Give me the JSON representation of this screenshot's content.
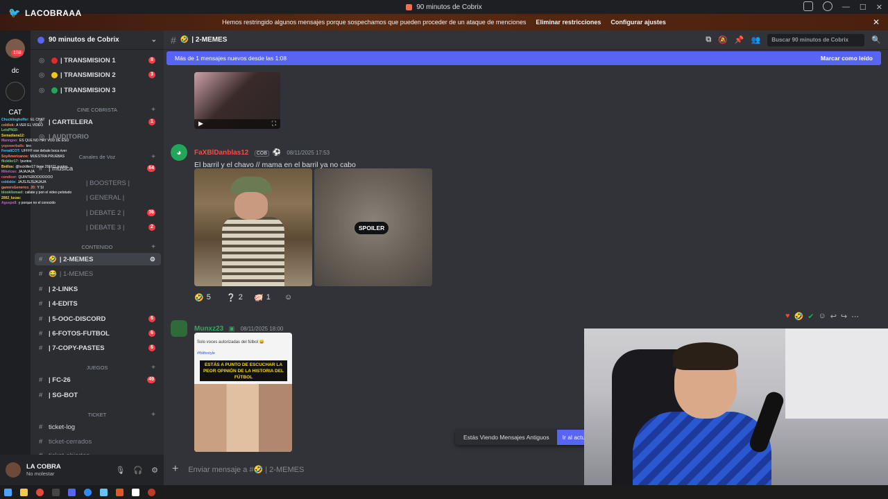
{
  "window": {
    "title": "90 minutos de Cobrix",
    "controls": [
      "—",
      "☐",
      "✕"
    ]
  },
  "stream_logo": "LACOBRAAA",
  "warning": {
    "text": "Hemos restringido algunos mensajes porque sospechamos que pueden proceder de un ataque de menciones",
    "link1": "Eliminar restricciones",
    "link2": "Configurar ajustes",
    "close": "✕"
  },
  "rail": {
    "items": [
      "dc",
      "CAT"
    ],
    "badge": "188"
  },
  "server": {
    "name": "90 minutos de Cobrix",
    "chevron": "⌄"
  },
  "channels": [
    {
      "label": "| TRANSMISION 1",
      "dot": "#e02b2b",
      "count": "8"
    },
    {
      "label": "| TRANSMISION 2",
      "dot": "#f0c419",
      "count": "3"
    },
    {
      "label": "| TRANSMISION 3",
      "dot": "#23a55a",
      "count": ""
    },
    {
      "label": "| CARTELERA",
      "count": "1"
    },
    {
      "label": "| AUDITORIO",
      "count": ""
    },
    {
      "label": "| musica",
      "count": "64"
    },
    {
      "label": "| BOOSTERS |",
      "count": ""
    },
    {
      "label": "| GENERAL |",
      "count": ""
    },
    {
      "label": "| DEBATE 2 |",
      "count": "36"
    },
    {
      "label": "| DEBATE 3 |",
      "count": "2"
    },
    {
      "label": "| 2-MEMES",
      "count": ""
    },
    {
      "label": "| 1-MEMES",
      "count": ""
    },
    {
      "label": "| 2-LINKS",
      "count": ""
    },
    {
      "label": "| 4-EDITS",
      "count": ""
    },
    {
      "label": "| 5-OOC-DISCORD",
      "count": "6"
    },
    {
      "label": "| 6-FOTOS-FUTBOL",
      "count": "6"
    },
    {
      "label": "| 7-COPY-PASTES",
      "count": "6"
    },
    {
      "label": "| FC-26",
      "count": "49"
    },
    {
      "label": "| SG-BOT",
      "count": ""
    },
    {
      "label": "ticket-log",
      "count": ""
    },
    {
      "label": "ticket-cerrados",
      "count": ""
    },
    {
      "label": "ticket-abiertos",
      "count": ""
    }
  ],
  "categories": [
    "CINE COBRISTA",
    "Canales de Voz",
    "CONTENIDO",
    "JUEGOS",
    "TICKET"
  ],
  "user": {
    "name": "LA COBRA",
    "status": "No molestar"
  },
  "chat_overlay": [
    {
      "u": "Chucklinghoffer:",
      "m": "EL CHAT"
    },
    {
      "u": "coldlok:",
      "m": "A VER EL VIDEO"
    },
    {
      "u": "LeisPN10:",
      "m": ""
    },
    {
      "u": "Semadiana12:",
      "m": ""
    },
    {
      "u": "Manngoo:",
      "m": "ES QUE NO HAY VOD DE ESO"
    },
    {
      "u": "yopowerballs:",
      "m": "bro"
    },
    {
      "u": "FerraliCOT:",
      "m": "UFFFF ese debate boca river"
    },
    {
      "u": "SoyAmericanos:",
      "m": "MUESTRA PRUEBAS"
    },
    {
      "u": "flicktler17:",
      "m": "!puntos"
    },
    {
      "u": "Bnillos:",
      "m": "@tocklilier17 tiene 291611 puntos"
    },
    {
      "u": "Mikelcas:",
      "m": "JAJAJAJA"
    },
    {
      "u": "condicer:",
      "m": "QUINTEROOOOOOO"
    },
    {
      "u": "coldskie:",
      "m": "JAJSJSJSJAJAJA"
    },
    {
      "u": "gamersGenerico_20:",
      "m": "Y SI"
    },
    {
      "u": "blooklismael:",
      "m": "callate y pon el video pelotudo"
    },
    {
      "u": "2002_lucas:",
      "m": ""
    },
    {
      "u": "Agusps8:",
      "m": "y porque no el conocido"
    }
  ],
  "header": {
    "channel": "2-MEMES",
    "search_placeholder": "Buscar 90 minutos de Cobrix"
  },
  "new_messages": {
    "text": "Más de 1 mensajes nuevos desde las 1:08",
    "action": "Marcar como leído"
  },
  "messages": [
    {
      "author": "FaXBlDanblas12",
      "tag": "COB",
      "timestamp": "08/11/2025 17:53",
      "text": "El barril y el chavo // mama en el barril ya no cabo",
      "spoiler": "SPOILER"
    },
    {
      "author": "Munxz23",
      "timestamp": "08/11/2025 18:00",
      "embed_title": "Solo voces autorizadas del fútbol 😄",
      "embed_tag": "#fblifestyle",
      "embed_banner": "ESTÁS A PUNTO DE ESCUCHAR LA PEOR OPINIÓN DE LA HISTORIA DEL FÚTBOL"
    }
  ],
  "reactions": [
    {
      "emoji": "🤣",
      "count": "5"
    },
    {
      "emoji": "❔",
      "count": "2"
    },
    {
      "emoji": "🐖",
      "count": "1"
    }
  ],
  "older": {
    "text": "Estás Viendo Mensajes Antiguos",
    "button": "Ir al actua"
  },
  "composer": {
    "placeholder": "Enviar mensaje a #🤣 | 2-MEMES"
  },
  "colors": {
    "blurple": "#5865f2",
    "danger": "#f23f43",
    "author1": "#e8524a",
    "author2": "#3ba55c"
  }
}
